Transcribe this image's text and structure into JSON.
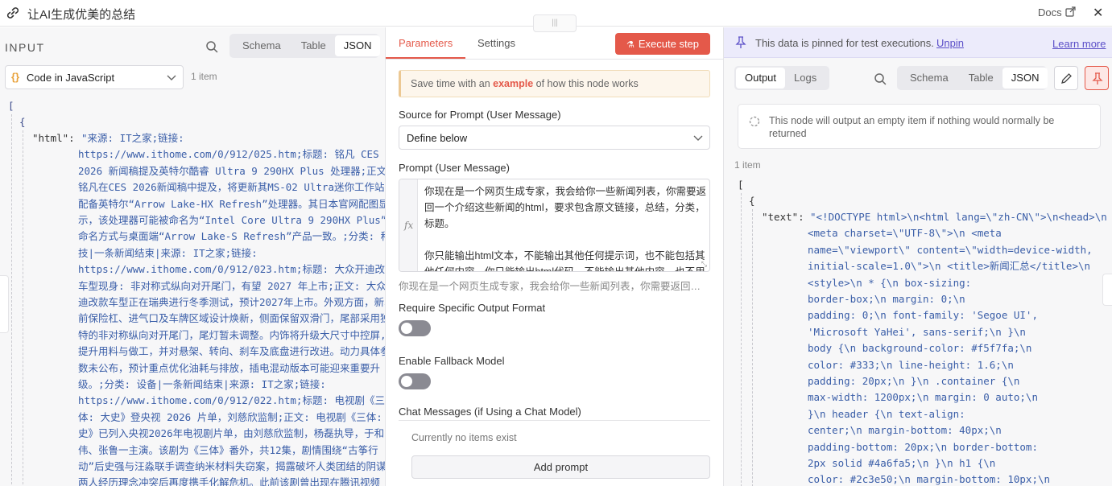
{
  "header": {
    "title": "让AI生成优美的总结",
    "docs_label": "Docs",
    "close_symbol": "✕",
    "drag_handle_symbol": "|||"
  },
  "input_panel": {
    "label": "INPUT",
    "views": [
      "Schema",
      "Table",
      "JSON"
    ],
    "active_view": "JSON",
    "node_selector": "Code in JavaScript",
    "item_count": "1 item",
    "json": {
      "open_array": "[",
      "open_object": "{",
      "key": "\"html\":",
      "value_lines": [
        "\"来源: IT之家;链接:",
        "https://www.ithome.com/0/912/025.htm;标题: 铭凡 CES",
        "2026 新闻稿提及英特尔酷睿 Ultra 9 290HX Plus 处理器;正文:",
        "铭凡在CES 2026新闻稿中提及，将更新其MS-02 Ultra迷你工作站,",
        "配备英特尔“Arrow Lake-HX Refresh”处理器。其日本官网配图显",
        "示，该处理器可能被命名为“Intel Core Ultra 9 290HX Plus”,",
        "命名方式与桌面端“Arrow Lake-S Refresh”产品一致。;分类: 科",
        "技|一条新闻结束|来源: IT之家;链接:",
        "https://www.ithome.com/0/912/023.htm;标题: 大众开迪改款",
        "车型现身: 非对称式纵向对开尾门，有望 2027 年上市;正文: 大众开",
        "迪改款车型正在瑞典进行冬季测试，预计2027年上市。外观方面，新车",
        "前保险杠、进气口及车牌区域设计焕新，侧面保留双滑门，尾部采用独",
        "特的非对称纵向对开尾门，尾灯暂未调整。内饰将升级大尺寸中控屏,",
        "提升用料与做工，并对悬架、转向、刹车及底盘进行改进。动力具体参",
        "数未公布，预计重点优化油耗与排放，插电混动版本可能迎来重要升",
        "级。;分类: 设备|一条新闻结束|来源: IT之家;链接:",
        "https://www.ithome.com/0/912/022.htm;标题: 电视剧《三",
        "体: 大史》登央视 2026 片单，刘慈欣监制;正文: 电视剧《三体: 大",
        "史》已列入央视2026年电视剧片单，由刘慈欣监制，杨磊执导，于和",
        "伟、张鲁一主演。该剧为《三体》番外，共12集，剧情围绕“古筝行",
        "动”后史强与汪淼联手调查纳米材料失窃案，揭露破坏人类团结的阴谋,",
        "两人经历理念冲突后再度携手化解危机。此前该剧曾出现在腾讯视频"
      ]
    }
  },
  "parameters_panel": {
    "tabs": [
      "Parameters",
      "Settings"
    ],
    "active_tab": "Parameters",
    "execute_label": "Execute step",
    "hint_prefix": "Save time with an ",
    "hint_link": "example",
    "hint_suffix": " of how this node works",
    "source_label": "Source for Prompt (User Message)",
    "source_value": "Define below",
    "prompt_label": "Prompt (User Message)",
    "prompt_lines": [
      "你现在是一个网页生成专家，我会给你一些新闻列表，你需要返回一个介绍这些新闻的html，要求包含原文链接，总结，分类，标题。",
      "你只能输出html文本，不能输出其他任何提示词，也不能包括其他任何内容，你只能输出html代码，不能输出其他内容，也不用"
    ],
    "prompt_preview": "你现在是一个网页生成专家，我会给你一些新闻列表，你需要返回一个介绍这些新闻的html，要求包含原文链接，总结，分类，标题。",
    "require_format_label": "Require Specific Output Format",
    "require_format_enabled": false,
    "fallback_label": "Enable Fallback Model",
    "fallback_enabled": false,
    "chat_messages_label": "Chat Messages (if Using a Chat Model)",
    "no_items_text": "Currently no items exist",
    "add_prompt_label": "Add prompt"
  },
  "output_panel": {
    "pinned_message": "This data is pinned for test executions.",
    "unpin_label": "Unpin",
    "learn_more_label": "Learn more",
    "output_tabs": [
      "Output",
      "Logs"
    ],
    "active_output_tab": "Output",
    "views": [
      "Schema",
      "Table",
      "JSON"
    ],
    "active_view": "JSON",
    "notice": "This node will output an empty item if nothing would normally be returned",
    "item_count": "1 item",
    "json": {
      "open_array": "[",
      "open_object": "{",
      "key": "\"text\":",
      "value_lines": [
        "\"<!DOCTYPE html>\\n<html lang=\\\"zh-CN\\\">\\n<head>\\n",
        "<meta charset=\\\"UTF-8\\\">\\n    <meta",
        "name=\\\"viewport\\\" content=\\\"width=device-width,",
        "initial-scale=1.0\\\">\\n    <title>新闻汇总</title>\\n",
        "<style>\\n        * {\\n            box-sizing:",
        "border-box;\\n            margin: 0;\\n",
        "padding: 0;\\n            font-family: 'Segoe UI',",
        "'Microsoft YaHei', sans-serif;\\n        }\\n",
        "body {\\n            background-color: #f5f7fa;\\n",
        "color: #333;\\n            line-height: 1.6;\\n",
        "padding: 20px;\\n        }\\n        .container {\\n",
        "max-width: 1200px;\\n            margin: 0 auto;\\n",
        "}\\n        header {\\n            text-align:",
        "center;\\n            margin-bottom: 40px;\\n",
        "padding-bottom: 20px;\\n            border-bottom:",
        "2px solid #4a6fa5;\\n        }\\n        h1 {\\n",
        "color: #2c3e50;\\n            margin-bottom: 10px;\\n"
      ]
    }
  },
  "colors": {
    "accent": "#e4594a",
    "link": "#5b4fc8",
    "json_string": "#3a5ea8",
    "pinned_banner": "#ecebfb"
  }
}
